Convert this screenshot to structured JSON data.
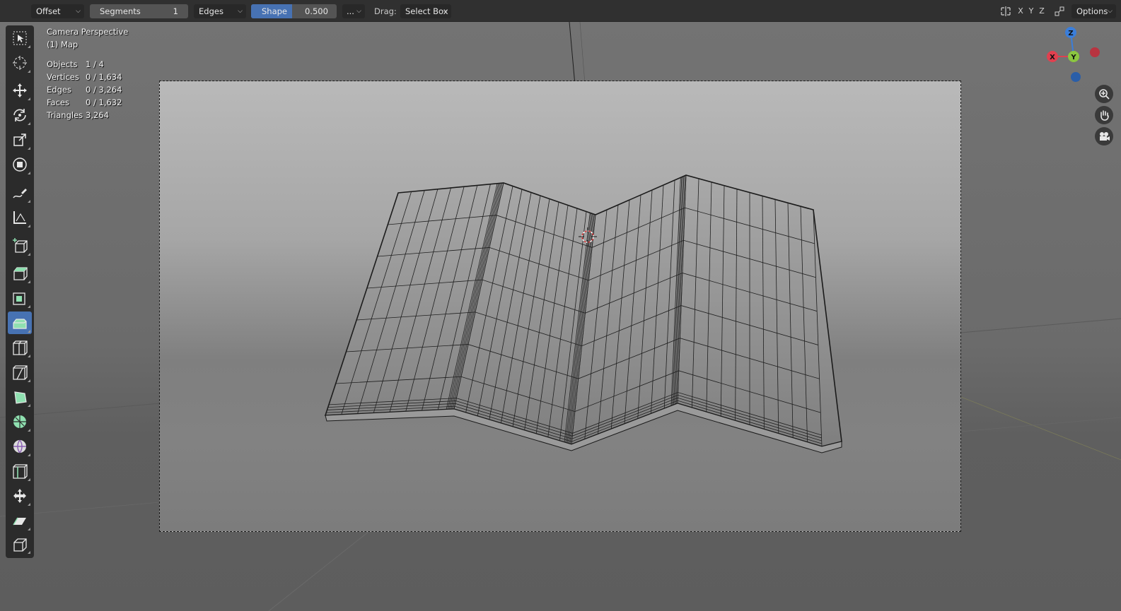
{
  "header": {
    "mode_dropdown": "Offset",
    "segments_label": "Segments",
    "segments_value": "1",
    "affect_dropdown": "Edges",
    "shape_label": "Shape",
    "shape_value": "0.500",
    "more_dropdown": "...",
    "drag_label": "Drag:",
    "drag_dropdown": "Select Box",
    "axis_x": "X",
    "axis_y": "Y",
    "axis_z": "Z",
    "options_label": "Options"
  },
  "overlay": {
    "view_name": "Camera Perspective",
    "object_name": "(1) Map",
    "stats": [
      {
        "label": "Objects",
        "value": "1 / 4"
      },
      {
        "label": "Vertices",
        "value": "0 / 1,634"
      },
      {
        "label": "Edges",
        "value": "0 / 3,264"
      },
      {
        "label": "Faces",
        "value": "0 / 1,632"
      },
      {
        "label": "Triangles",
        "value": "3,264"
      }
    ]
  },
  "gizmo": {
    "z_label": "Z",
    "y_label": "Y",
    "x_label": "X",
    "colors": {
      "x": "#e0404f",
      "y": "#8bc640",
      "z": "#3b7ed9"
    }
  },
  "toolbar": {
    "tools": [
      "select-box",
      "cursor",
      "move",
      "rotate",
      "scale",
      "transform",
      "annotate",
      "measure",
      "add-cube",
      "extrude-region",
      "inset-faces",
      "bevel",
      "loop-cut",
      "knife",
      "poly-build",
      "spin",
      "smooth",
      "edge-slide",
      "shrink-fatten",
      "shear",
      "rip-region"
    ],
    "active_tool": "bevel"
  },
  "colors": {
    "accent": "#4772b3",
    "header_bg": "#303030",
    "toolbar_bg": "#2b2b2b"
  }
}
